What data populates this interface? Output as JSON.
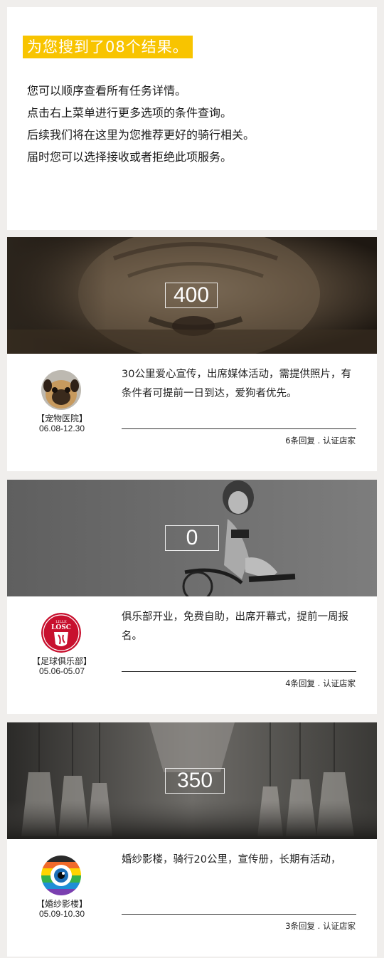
{
  "header": {
    "title": "为您搜到了08个结果。",
    "lines": [
      "您可以顺序查看所有任务详情。",
      "点击右上菜单进行更多选项的条件查询。",
      "后续我们将在这里为您推荐更好的骑行相关。",
      "届时您可以选择接收或者拒绝此项服务。"
    ]
  },
  "cards": [
    {
      "count": "400",
      "shop": "【宠物医院】",
      "date": "06.08-12.30",
      "desc": "30公里爱心宣传，出席媒体活动，需提供照片，有条件者可提前一日到达，爱狗者优先。",
      "meta": "6条回复 . 认证店家"
    },
    {
      "count": "0",
      "shop": "【足球俱乐部】",
      "date": "05.06-05.07",
      "desc": "俱乐部开业，免费自助，出席开幕式，提前一周报名。",
      "meta": "4条回复 . 认证店家"
    },
    {
      "count": "350",
      "shop": "【婚纱影楼】",
      "date": "05.09-10.30",
      "desc": "婚纱影楼，骑行20公里，宣传册，长期有活动，",
      "meta": "3条回复 . 认证店家"
    }
  ],
  "logos": {
    "losc_text": "LOSC",
    "losc_small": "LILLE"
  },
  "colors": {
    "accent": "#f8c400",
    "losc_red": "#c8102e"
  }
}
